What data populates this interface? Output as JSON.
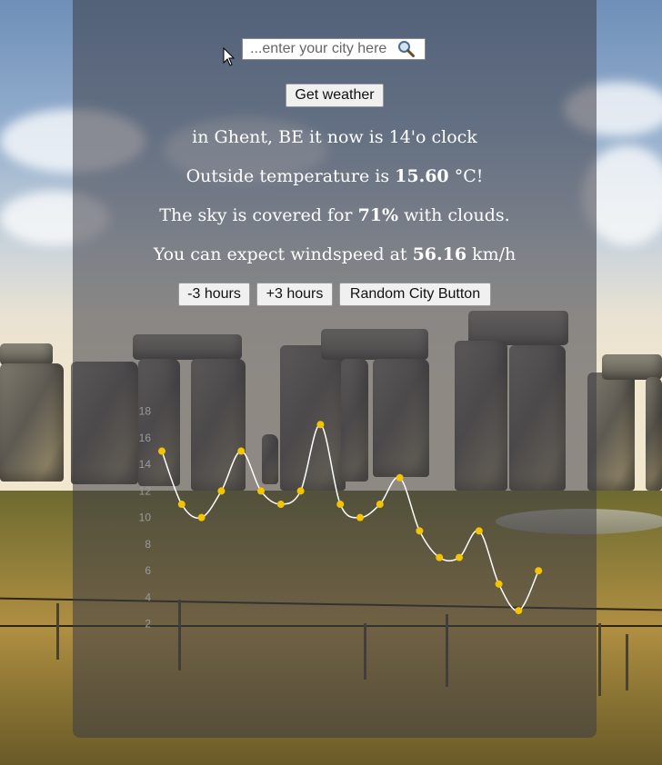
{
  "search": {
    "placeholder": "...enter your city here"
  },
  "buttons": {
    "get_weather": "Get weather",
    "minus_3h": "-3 hours",
    "plus_3h": "+3 hours",
    "random_city": "Random City Button"
  },
  "info": {
    "location_prefix": "in Ghent, BE it now is ",
    "time": "14'o clock",
    "temp_prefix": "Outside temperature is ",
    "temp_value": "15.60",
    "temp_suffix": " °C!",
    "sky_prefix": "The sky is covered for ",
    "sky_value": "71%",
    "sky_suffix": " with clouds.",
    "wind_prefix": "You can expect windspeed at ",
    "wind_value": "56.16",
    "wind_suffix": " km/h"
  },
  "chart_data": {
    "type": "line",
    "y_ticks": [
      "2",
      "4",
      "6",
      "8",
      "10",
      "12",
      "14",
      "16",
      "18"
    ],
    "ylim": [
      0,
      19
    ],
    "values": [
      15.0,
      11.0,
      10.0,
      12.0,
      15.0,
      12.0,
      11.0,
      12.0,
      17.0,
      11.0,
      10.0,
      11.0,
      13.0,
      9.0,
      7.0,
      7.0,
      9.0,
      5.0,
      3.0,
      6.0
    ],
    "colors": {
      "line": "#ffffff",
      "point": "#f5c400",
      "tick": "#9a9a9a"
    }
  }
}
